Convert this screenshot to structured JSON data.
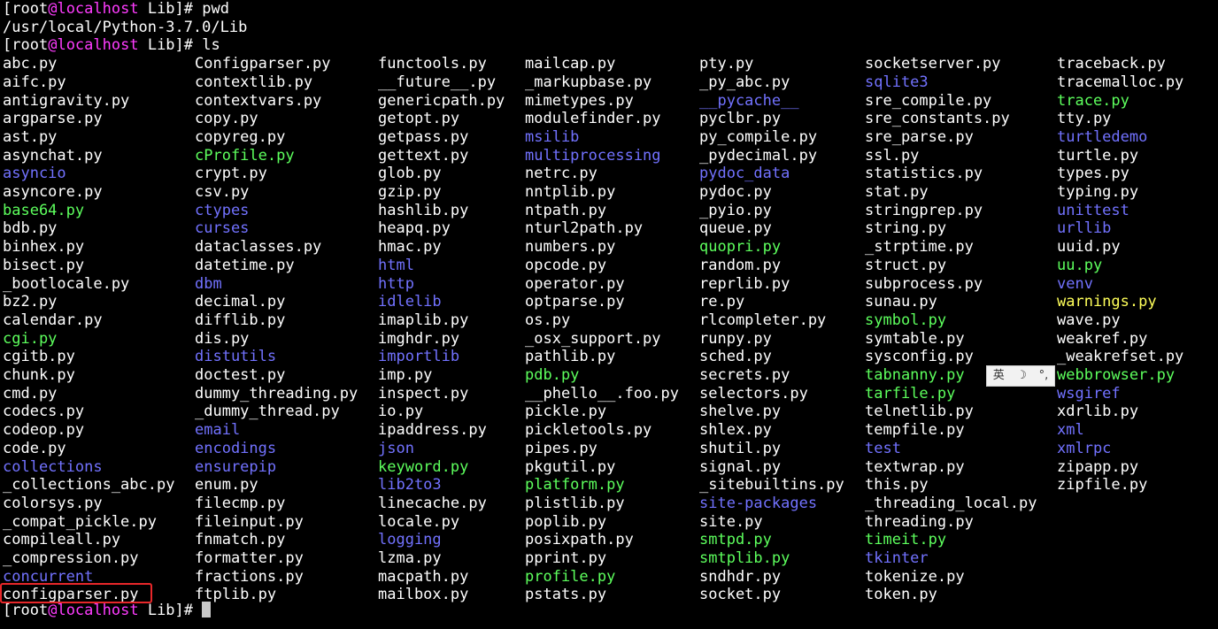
{
  "prompt": {
    "user": "root",
    "at": "@",
    "host": "localhost",
    "dir": "Lib"
  },
  "commands": {
    "first": "pwd",
    "second": "ls"
  },
  "pwd_output": "/usr/local/Python-3.7.0/Lib",
  "colors": {
    "background": "#000000",
    "file": "#ffffff",
    "directory": "#7272ff",
    "executable": "#5dff5d",
    "special": "#ffff5a",
    "host": "#ff3cff",
    "highlight": "#e8272a"
  },
  "highlighted_entry": "configparser.py",
  "ime": {
    "label": "英",
    "icons": [
      "moon-icon",
      "punctuation-icon"
    ]
  },
  "ls_columns": [
    [
      {
        "n": "abc.py",
        "t": "file"
      },
      {
        "n": "aifc.py",
        "t": "file"
      },
      {
        "n": "antigravity.py",
        "t": "file"
      },
      {
        "n": "argparse.py",
        "t": "file"
      },
      {
        "n": "ast.py",
        "t": "file"
      },
      {
        "n": "asynchat.py",
        "t": "file"
      },
      {
        "n": "asyncio",
        "t": "dir"
      },
      {
        "n": "asyncore.py",
        "t": "file"
      },
      {
        "n": "base64.py",
        "t": "exec"
      },
      {
        "n": "bdb.py",
        "t": "file"
      },
      {
        "n": "binhex.py",
        "t": "file"
      },
      {
        "n": "bisect.py",
        "t": "file"
      },
      {
        "n": "_bootlocale.py",
        "t": "file"
      },
      {
        "n": "bz2.py",
        "t": "file"
      },
      {
        "n": "calendar.py",
        "t": "file"
      },
      {
        "n": "cgi.py",
        "t": "exec"
      },
      {
        "n": "cgitb.py",
        "t": "file"
      },
      {
        "n": "chunk.py",
        "t": "file"
      },
      {
        "n": "cmd.py",
        "t": "file"
      },
      {
        "n": "codecs.py",
        "t": "file"
      },
      {
        "n": "codeop.py",
        "t": "file"
      },
      {
        "n": "code.py",
        "t": "file"
      },
      {
        "n": "collections",
        "t": "dir"
      },
      {
        "n": "_collections_abc.py",
        "t": "file"
      },
      {
        "n": "colorsys.py",
        "t": "file"
      },
      {
        "n": "_compat_pickle.py",
        "t": "file"
      },
      {
        "n": "compileall.py",
        "t": "file"
      },
      {
        "n": "_compression.py",
        "t": "file"
      },
      {
        "n": "concurrent",
        "t": "dir"
      },
      {
        "n": "configparser.py",
        "t": "file"
      }
    ],
    [
      {
        "n": "Configparser.py",
        "t": "file"
      },
      {
        "n": "contextlib.py",
        "t": "file"
      },
      {
        "n": "contextvars.py",
        "t": "file"
      },
      {
        "n": "copy.py",
        "t": "file"
      },
      {
        "n": "copyreg.py",
        "t": "file"
      },
      {
        "n": "cProfile.py",
        "t": "exec"
      },
      {
        "n": "crypt.py",
        "t": "file"
      },
      {
        "n": "csv.py",
        "t": "file"
      },
      {
        "n": "ctypes",
        "t": "dir"
      },
      {
        "n": "curses",
        "t": "dir"
      },
      {
        "n": "dataclasses.py",
        "t": "file"
      },
      {
        "n": "datetime.py",
        "t": "file"
      },
      {
        "n": "dbm",
        "t": "dir"
      },
      {
        "n": "decimal.py",
        "t": "file"
      },
      {
        "n": "difflib.py",
        "t": "file"
      },
      {
        "n": "dis.py",
        "t": "file"
      },
      {
        "n": "distutils",
        "t": "dir"
      },
      {
        "n": "doctest.py",
        "t": "file"
      },
      {
        "n": "dummy_threading.py",
        "t": "file"
      },
      {
        "n": "_dummy_thread.py",
        "t": "file"
      },
      {
        "n": "email",
        "t": "dir"
      },
      {
        "n": "encodings",
        "t": "dir"
      },
      {
        "n": "ensurepip",
        "t": "dir"
      },
      {
        "n": "enum.py",
        "t": "file"
      },
      {
        "n": "filecmp.py",
        "t": "file"
      },
      {
        "n": "fileinput.py",
        "t": "file"
      },
      {
        "n": "fnmatch.py",
        "t": "file"
      },
      {
        "n": "formatter.py",
        "t": "file"
      },
      {
        "n": "fractions.py",
        "t": "file"
      },
      {
        "n": "ftplib.py",
        "t": "file"
      }
    ],
    [
      {
        "n": "functools.py",
        "t": "file"
      },
      {
        "n": "__future__.py",
        "t": "file"
      },
      {
        "n": "genericpath.py",
        "t": "file"
      },
      {
        "n": "getopt.py",
        "t": "file"
      },
      {
        "n": "getpass.py",
        "t": "file"
      },
      {
        "n": "gettext.py",
        "t": "file"
      },
      {
        "n": "glob.py",
        "t": "file"
      },
      {
        "n": "gzip.py",
        "t": "file"
      },
      {
        "n": "hashlib.py",
        "t": "file"
      },
      {
        "n": "heapq.py",
        "t": "file"
      },
      {
        "n": "hmac.py",
        "t": "file"
      },
      {
        "n": "html",
        "t": "dir"
      },
      {
        "n": "http",
        "t": "dir"
      },
      {
        "n": "idlelib",
        "t": "dir"
      },
      {
        "n": "imaplib.py",
        "t": "file"
      },
      {
        "n": "imghdr.py",
        "t": "file"
      },
      {
        "n": "importlib",
        "t": "dir"
      },
      {
        "n": "imp.py",
        "t": "file"
      },
      {
        "n": "inspect.py",
        "t": "file"
      },
      {
        "n": "io.py",
        "t": "file"
      },
      {
        "n": "ipaddress.py",
        "t": "file"
      },
      {
        "n": "json",
        "t": "dir"
      },
      {
        "n": "keyword.py",
        "t": "exec"
      },
      {
        "n": "lib2to3",
        "t": "dir"
      },
      {
        "n": "linecache.py",
        "t": "file"
      },
      {
        "n": "locale.py",
        "t": "file"
      },
      {
        "n": "logging",
        "t": "dir"
      },
      {
        "n": "lzma.py",
        "t": "file"
      },
      {
        "n": "macpath.py",
        "t": "file"
      },
      {
        "n": "mailbox.py",
        "t": "file"
      }
    ],
    [
      {
        "n": "mailcap.py",
        "t": "file"
      },
      {
        "n": "_markupbase.py",
        "t": "file"
      },
      {
        "n": "mimetypes.py",
        "t": "file"
      },
      {
        "n": "modulefinder.py",
        "t": "file"
      },
      {
        "n": "msilib",
        "t": "dir"
      },
      {
        "n": "multiprocessing",
        "t": "dir"
      },
      {
        "n": "netrc.py",
        "t": "file"
      },
      {
        "n": "nntplib.py",
        "t": "file"
      },
      {
        "n": "ntpath.py",
        "t": "file"
      },
      {
        "n": "nturl2path.py",
        "t": "file"
      },
      {
        "n": "numbers.py",
        "t": "file"
      },
      {
        "n": "opcode.py",
        "t": "file"
      },
      {
        "n": "operator.py",
        "t": "file"
      },
      {
        "n": "optparse.py",
        "t": "file"
      },
      {
        "n": "os.py",
        "t": "file"
      },
      {
        "n": "_osx_support.py",
        "t": "file"
      },
      {
        "n": "pathlib.py",
        "t": "file"
      },
      {
        "n": "pdb.py",
        "t": "exec"
      },
      {
        "n": "__phello__.foo.py",
        "t": "file"
      },
      {
        "n": "pickle.py",
        "t": "file"
      },
      {
        "n": "pickletools.py",
        "t": "file"
      },
      {
        "n": "pipes.py",
        "t": "file"
      },
      {
        "n": "pkgutil.py",
        "t": "file"
      },
      {
        "n": "platform.py",
        "t": "exec"
      },
      {
        "n": "plistlib.py",
        "t": "file"
      },
      {
        "n": "poplib.py",
        "t": "file"
      },
      {
        "n": "posixpath.py",
        "t": "file"
      },
      {
        "n": "pprint.py",
        "t": "file"
      },
      {
        "n": "profile.py",
        "t": "exec"
      },
      {
        "n": "pstats.py",
        "t": "file"
      }
    ],
    [
      {
        "n": "pty.py",
        "t": "file"
      },
      {
        "n": "_py_abc.py",
        "t": "file"
      },
      {
        "n": "__pycache__",
        "t": "dir"
      },
      {
        "n": "pyclbr.py",
        "t": "file"
      },
      {
        "n": "py_compile.py",
        "t": "file"
      },
      {
        "n": "_pydecimal.py",
        "t": "file"
      },
      {
        "n": "pydoc_data",
        "t": "dir"
      },
      {
        "n": "pydoc.py",
        "t": "file"
      },
      {
        "n": "_pyio.py",
        "t": "file"
      },
      {
        "n": "queue.py",
        "t": "file"
      },
      {
        "n": "quopri.py",
        "t": "exec"
      },
      {
        "n": "random.py",
        "t": "file"
      },
      {
        "n": "reprlib.py",
        "t": "file"
      },
      {
        "n": "re.py",
        "t": "file"
      },
      {
        "n": "rlcompleter.py",
        "t": "file"
      },
      {
        "n": "runpy.py",
        "t": "file"
      },
      {
        "n": "sched.py",
        "t": "file"
      },
      {
        "n": "secrets.py",
        "t": "file"
      },
      {
        "n": "selectors.py",
        "t": "file"
      },
      {
        "n": "shelve.py",
        "t": "file"
      },
      {
        "n": "shlex.py",
        "t": "file"
      },
      {
        "n": "shutil.py",
        "t": "file"
      },
      {
        "n": "signal.py",
        "t": "file"
      },
      {
        "n": "_sitebuiltins.py",
        "t": "file"
      },
      {
        "n": "site-packages",
        "t": "dir"
      },
      {
        "n": "site.py",
        "t": "file"
      },
      {
        "n": "smtpd.py",
        "t": "exec"
      },
      {
        "n": "smtplib.py",
        "t": "exec"
      },
      {
        "n": "sndhdr.py",
        "t": "file"
      },
      {
        "n": "socket.py",
        "t": "file"
      }
    ],
    [
      {
        "n": "socketserver.py",
        "t": "file"
      },
      {
        "n": "sqlite3",
        "t": "dir"
      },
      {
        "n": "sre_compile.py",
        "t": "file"
      },
      {
        "n": "sre_constants.py",
        "t": "file"
      },
      {
        "n": "sre_parse.py",
        "t": "file"
      },
      {
        "n": "ssl.py",
        "t": "file"
      },
      {
        "n": "statistics.py",
        "t": "file"
      },
      {
        "n": "stat.py",
        "t": "file"
      },
      {
        "n": "stringprep.py",
        "t": "file"
      },
      {
        "n": "string.py",
        "t": "file"
      },
      {
        "n": "_strptime.py",
        "t": "file"
      },
      {
        "n": "struct.py",
        "t": "file"
      },
      {
        "n": "subprocess.py",
        "t": "file"
      },
      {
        "n": "sunau.py",
        "t": "file"
      },
      {
        "n": "symbol.py",
        "t": "exec"
      },
      {
        "n": "symtable.py",
        "t": "file"
      },
      {
        "n": "sysconfig.py",
        "t": "file"
      },
      {
        "n": "tabnanny.py",
        "t": "exec"
      },
      {
        "n": "tarfile.py",
        "t": "exec"
      },
      {
        "n": "telnetlib.py",
        "t": "file"
      },
      {
        "n": "tempfile.py",
        "t": "file"
      },
      {
        "n": "test",
        "t": "dir"
      },
      {
        "n": "textwrap.py",
        "t": "file"
      },
      {
        "n": "this.py",
        "t": "file"
      },
      {
        "n": "_threading_local.py",
        "t": "file"
      },
      {
        "n": "threading.py",
        "t": "file"
      },
      {
        "n": "timeit.py",
        "t": "exec"
      },
      {
        "n": "tkinter",
        "t": "dir"
      },
      {
        "n": "tokenize.py",
        "t": "file"
      },
      {
        "n": "token.py",
        "t": "file"
      }
    ],
    [
      {
        "n": "traceback.py",
        "t": "file"
      },
      {
        "n": "tracemalloc.py",
        "t": "file"
      },
      {
        "n": "trace.py",
        "t": "exec"
      },
      {
        "n": "tty.py",
        "t": "file"
      },
      {
        "n": "turtledemo",
        "t": "dir"
      },
      {
        "n": "turtle.py",
        "t": "file"
      },
      {
        "n": "types.py",
        "t": "file"
      },
      {
        "n": "typing.py",
        "t": "file"
      },
      {
        "n": "unittest",
        "t": "dir"
      },
      {
        "n": "urllib",
        "t": "dir"
      },
      {
        "n": "uuid.py",
        "t": "file"
      },
      {
        "n": "uu.py",
        "t": "exec"
      },
      {
        "n": "venv",
        "t": "dir"
      },
      {
        "n": "warnings.py",
        "t": "warn"
      },
      {
        "n": "wave.py",
        "t": "file"
      },
      {
        "n": "weakref.py",
        "t": "file"
      },
      {
        "n": "_weakrefset.py",
        "t": "file"
      },
      {
        "n": "webbrowser.py",
        "t": "exec"
      },
      {
        "n": "wsgiref",
        "t": "dir"
      },
      {
        "n": "xdrlib.py",
        "t": "file"
      },
      {
        "n": "xml",
        "t": "dir"
      },
      {
        "n": "xmlrpc",
        "t": "dir"
      },
      {
        "n": "zipapp.py",
        "t": "file"
      },
      {
        "n": "zipfile.py",
        "t": "file"
      }
    ]
  ]
}
